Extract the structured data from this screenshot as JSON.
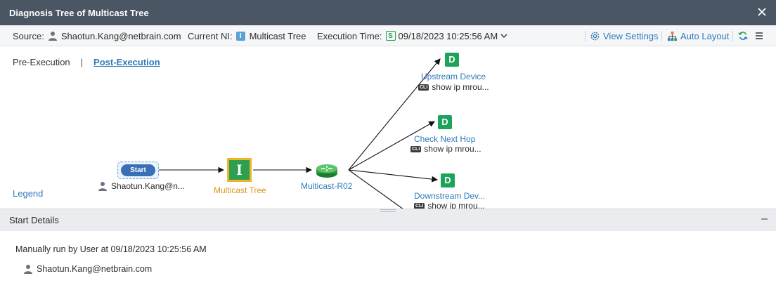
{
  "window": {
    "title": "Diagnosis Tree of Multicast Tree"
  },
  "toolbar": {
    "source_label": "Source:",
    "source_value": "Shaotun.Kang@netbrain.com",
    "ni_label": "Current NI:",
    "ni_badge": "I",
    "ni_value": "Multicast Tree",
    "exec_label": "Execution Time:",
    "exec_badge": "S",
    "exec_value": "09/18/2023 10:25:56 AM",
    "view_settings": "View Settings",
    "auto_layout": "Auto Layout"
  },
  "tabs": {
    "pre": "Pre-Execution",
    "separator": "|",
    "post": "Post-Execution"
  },
  "legend": "Legend",
  "graph": {
    "start_button": "Start",
    "start_user": "Shaotun.Kang@n...",
    "ni_node_letter": "I",
    "ni_node_label": "Multicast Tree",
    "device_label": "Multicast-R02",
    "branches": [
      {
        "letter": "D",
        "label": "Upstream Device",
        "cli_badge": "CLI",
        "command": "show ip mrou..."
      },
      {
        "letter": "D",
        "label": "Check Next Hop",
        "cli_badge": "CLI",
        "command": "show ip mrou..."
      },
      {
        "letter": "D",
        "label": "Downstream Dev...",
        "cli_badge": "CLI",
        "command": "show ip mrou..."
      }
    ]
  },
  "details_panel": {
    "title": "Start Details",
    "collapse": "–",
    "summary": "Manually run by User at 09/18/2023 10:25:56 AM",
    "user": "Shaotun.Kang@netbrain.com"
  },
  "colors": {
    "titlebar": "#4a5663",
    "link": "#2f7ab9",
    "d_node": "#1ea35b",
    "i_node_fill": "#2e9e4f",
    "i_node_border": "#f0b429",
    "orange": "#e0931b"
  }
}
